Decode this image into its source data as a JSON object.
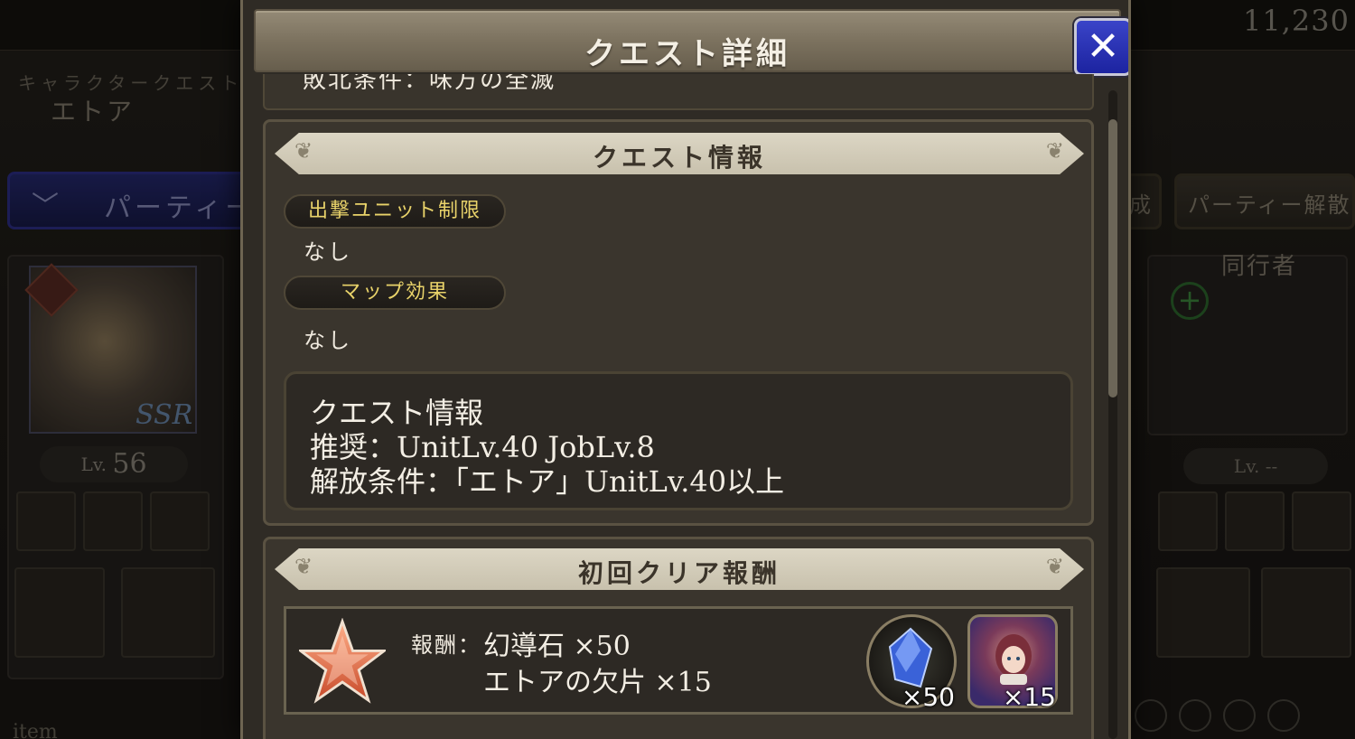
{
  "background": {
    "currency": "11,230",
    "quest_type": "キャラクタークエスト",
    "character_name": "エトア",
    "party_tab_label": "パーティー",
    "party_disband_label": "パーティー解散",
    "party_edit_fragment": "成",
    "unit_level_prefix": "Lv.",
    "unit_level_value": "56",
    "companion_label": "同行者",
    "companion_level": "Lv. --",
    "rarity_badge": "SSR",
    "item_label": "item"
  },
  "modal": {
    "title": "クエスト詳細",
    "close_label": "✕",
    "cut_off_text": "敗北条件：味方の全滅",
    "quest_info": {
      "banner_title": "クエスト情報",
      "sortie_limit_label": "出撃ユニット制限",
      "sortie_limit_value": "なし",
      "map_effect_label": "マップ効果",
      "map_effect_value": "なし",
      "info_heading": "クエスト情報",
      "recommended": "推奨：UnitLv.40 JobLv.8",
      "unlock_condition": "解放条件：「エトア」UnitLv.40以上"
    },
    "first_clear": {
      "banner_title": "初回クリア報酬",
      "reward_label": "報酬：",
      "reward_line1": "幻導石 ×50",
      "reward_line2": "エトアの欠片 ×15",
      "items": [
        {
          "name": "幻導石",
          "count_label": "×50",
          "icon": "crystal-icon"
        },
        {
          "name": "エトアの欠片",
          "count_label": "×15",
          "icon": "character-portrait-icon"
        }
      ]
    }
  },
  "colors": {
    "accent_yellow": "#e9d36a",
    "close_blue": "#1c23a0",
    "banner_light": "#dcd6c4"
  }
}
